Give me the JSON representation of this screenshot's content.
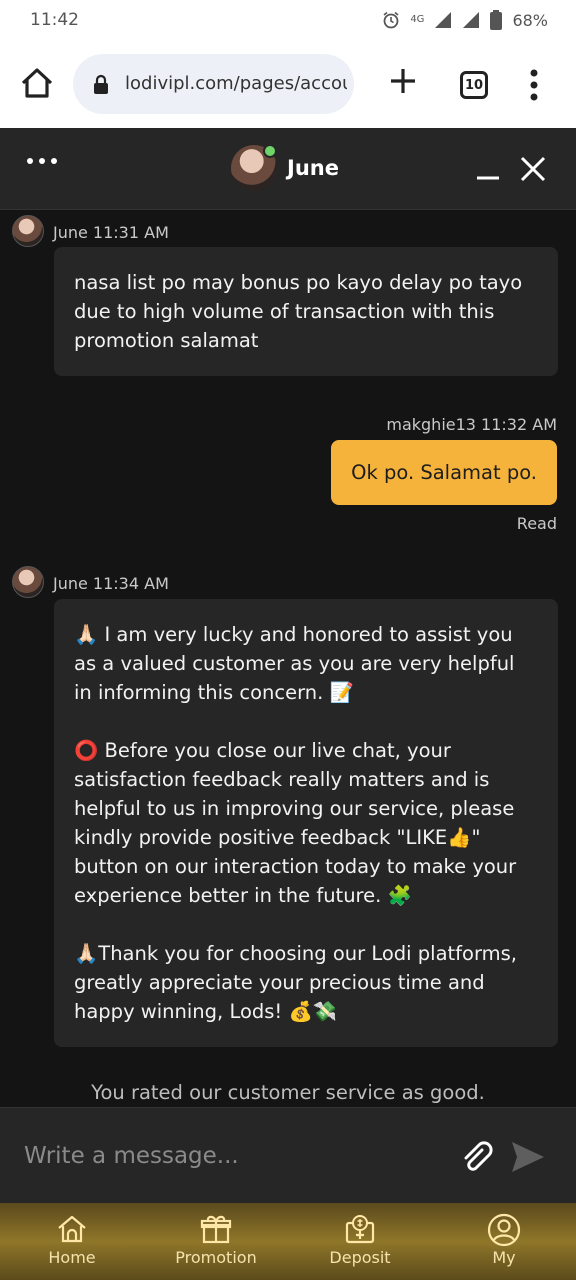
{
  "status_bar": {
    "time": "11:42",
    "network": "4G",
    "battery": "68%"
  },
  "browser": {
    "url": "lodivipl.com/pages/accou",
    "tab_count": "10"
  },
  "chat": {
    "agent_name": "June",
    "messages": [
      {
        "sender": "June",
        "time_label": "June 11:31 AM",
        "paragraphs": [
          "nasa list po may bonus po kayo delay po tayo due to high volume of transaction with this promotion salamat"
        ]
      },
      {
        "sender": "makghie13",
        "time_label": "makghie13 11:32 AM",
        "text": "Ok po. Salamat po.",
        "status": "Read"
      },
      {
        "sender": "June",
        "time_label": "June 11:34 AM",
        "paragraphs": [
          "🙏🏻 I am very lucky and honored to assist you as a valued customer as you are very helpful in informing this concern. 📝",
          "⭕ Before you close our live chat, your satisfaction feedback really matters and is helpful to us in improving our service, please kindly provide positive feedback \"LIKE👍\" button on our interaction today to make your experience better in the future. 🧩",
          "🙏🏻Thank you for choosing our Lodi platforms, greatly appreciate your precious time and happy winning, Lods! 💰💸"
        ]
      }
    ],
    "rating_notice": "You rated our customer service as good.",
    "input_placeholder": "Write a message..."
  },
  "bottom_nav": {
    "items": [
      {
        "label": "Home",
        "icon": "home-icon"
      },
      {
        "label": "Promotion",
        "icon": "gift-icon"
      },
      {
        "label": "Deposit",
        "icon": "deposit-icon"
      },
      {
        "label": "My",
        "icon": "user-icon"
      }
    ]
  },
  "colors": {
    "user_bubble": "#f6b33c",
    "agent_bubble": "#262626",
    "background": "#141414",
    "online": "#6fd46a",
    "nav_gold": "#8f7629"
  }
}
